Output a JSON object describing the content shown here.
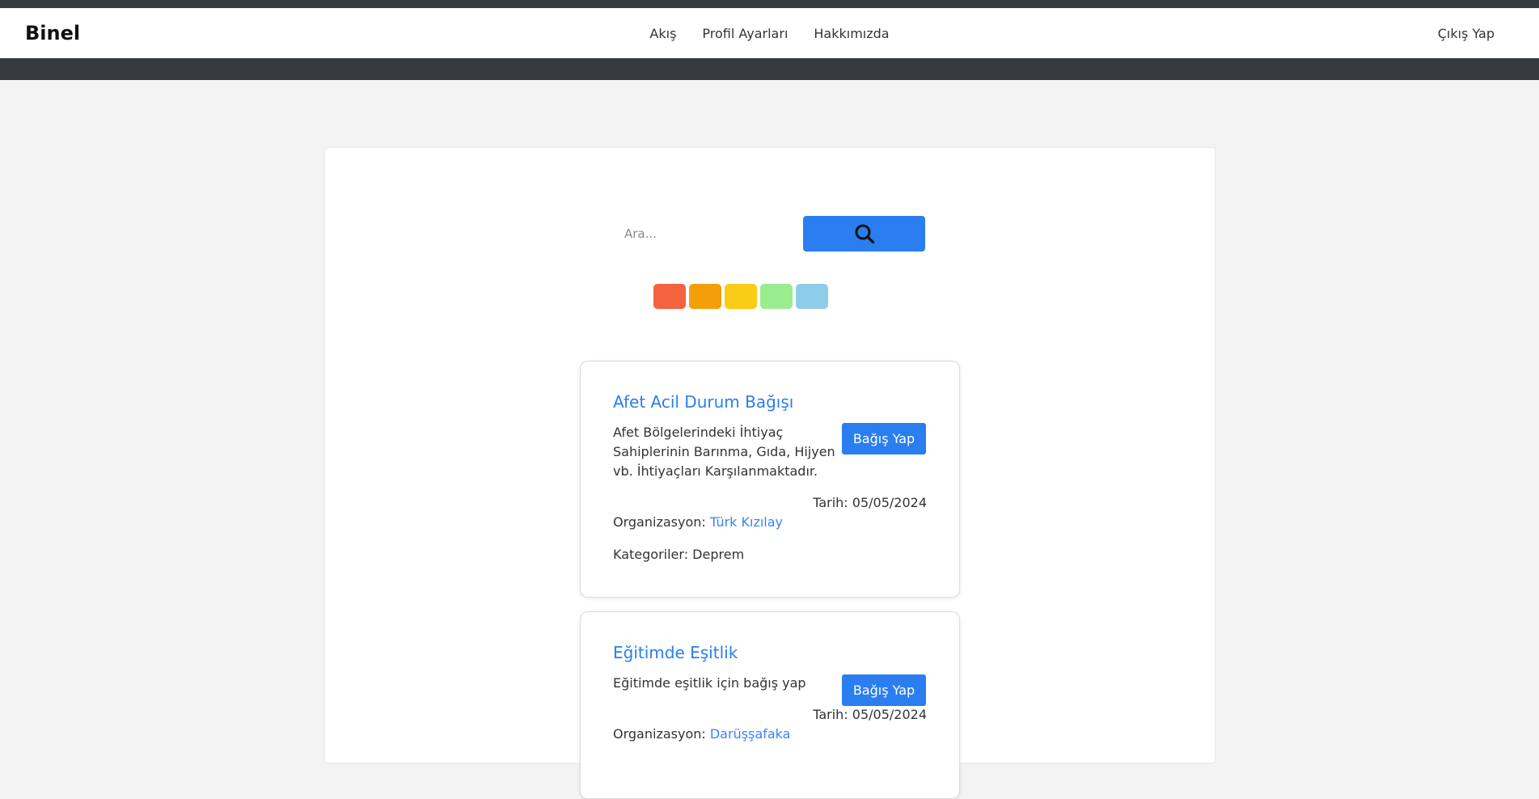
{
  "nav": {
    "brand": "Binel",
    "links": [
      "Akış",
      "Profil Ayarları",
      "Hakkımızda"
    ],
    "logout": "Çıkış Yap"
  },
  "search": {
    "placeholder": "Ara...",
    "button_icon": "search-icon"
  },
  "filters": {
    "colors": [
      "#f4623e",
      "#f59e0b",
      "#facc15",
      "#99ec8f",
      "#8ecdea"
    ]
  },
  "campaigns": [
    {
      "title": "Afet Acil Durum Bağışı",
      "description": "Afet Bölgelerindeki İhtiyaç Sahiplerinin Barınma, Gıda, Hijyen vb. İhtiyaçları Karşılanmaktadır.",
      "button": "Bağış Yap",
      "date_label": "Tarih:",
      "date": "05/05/2024",
      "org_label": "Organizasyon:",
      "org": "Türk Kızılay",
      "cat_label": "Kategoriler:",
      "categories": "Deprem"
    },
    {
      "title": "Eğitimde Eşitlik",
      "description": "Eğitimde eşitlik için bağış yap",
      "button": "Bağış Yap",
      "date_label": "Tarih:",
      "date": "05/05/2024",
      "org_label": "Organizasyon:",
      "org": "Darüşşafaka"
    }
  ],
  "colors": {
    "accent": "#2a7ef0",
    "dark_bar": "#343a40",
    "page_bg": "#f3f3f3"
  }
}
